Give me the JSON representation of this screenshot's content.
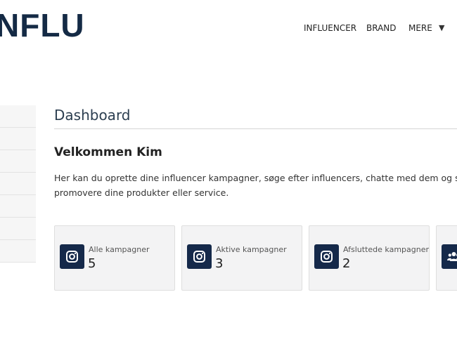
{
  "header": {
    "logo_text": "NFLU",
    "nav": [
      {
        "label": "INFLUENCER"
      },
      {
        "label": "BRAND"
      },
      {
        "label": "MERE"
      }
    ],
    "dropdown_icon": "caret-down-icon"
  },
  "sidebar": {
    "item_count": 7
  },
  "main": {
    "title": "Dashboard",
    "welcome": "Velkommen Kim",
    "intro_line1": "Her kan du oprette dine influencer kampagner, søge efter influencers, chatte med dem og sætt",
    "intro_line2": "promovere dine produkter eller service."
  },
  "cards": [
    {
      "label": "Alle kampagner",
      "value": "5",
      "icon": "instagram-icon"
    },
    {
      "label": "Aktive kampagner",
      "value": "3",
      "icon": "instagram-icon"
    },
    {
      "label": "Afsluttede kampagner",
      "value": "2",
      "icon": "instagram-icon"
    },
    {
      "label": "",
      "value": "",
      "icon": "users-icon"
    }
  ],
  "colors": {
    "brand_navy": "#142a45",
    "card_bg": "#f3f3f4",
    "icon_bg": "#15294a"
  }
}
